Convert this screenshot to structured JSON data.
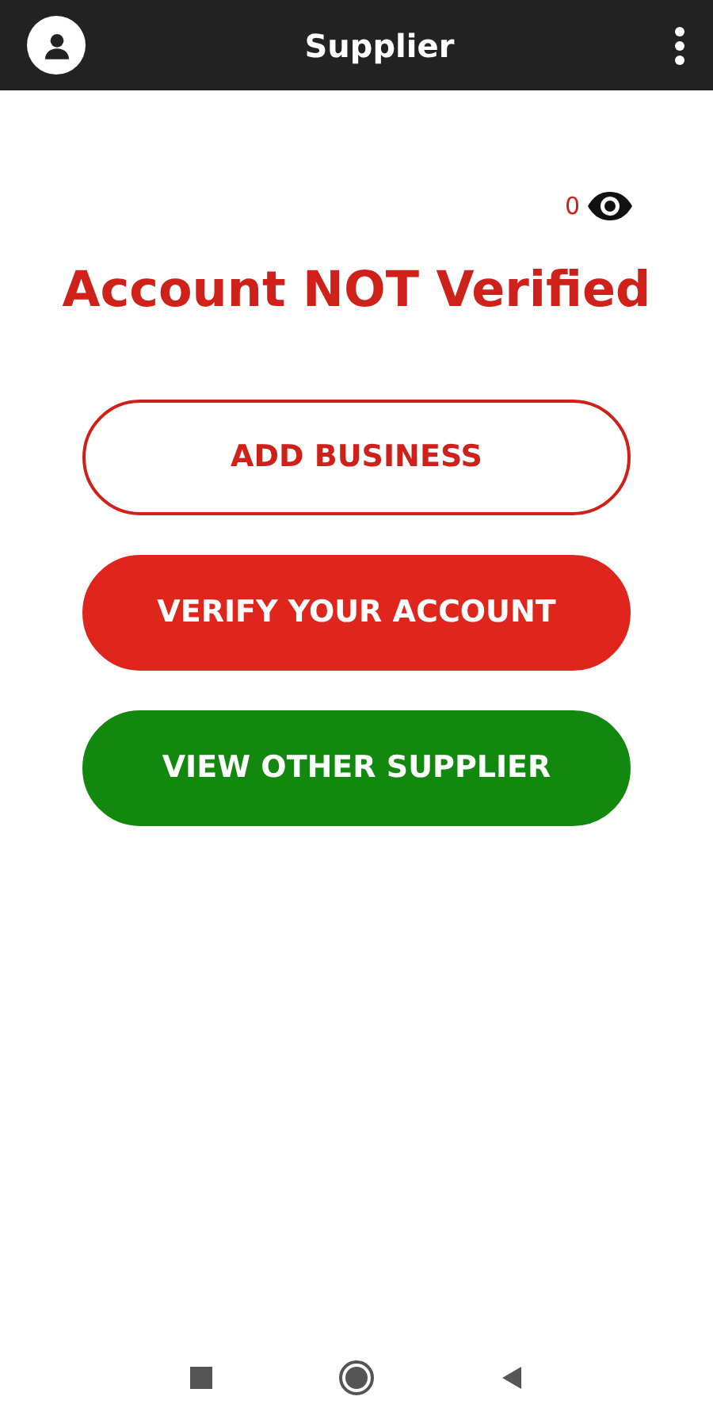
{
  "app_bar": {
    "title": "Supplier"
  },
  "views": {
    "count": "0"
  },
  "status_title": "Account NOT Verified",
  "buttons": [
    {
      "label": "ADD BUSINESS",
      "kind": "outline",
      "color": "#d0201a"
    },
    {
      "label": "VERIFY YOUR ACCOUNT",
      "kind": "filled",
      "color": "#df251c"
    },
    {
      "label": "VIEW OTHER SUPPLIER",
      "kind": "filled",
      "color": "#12880f"
    }
  ]
}
